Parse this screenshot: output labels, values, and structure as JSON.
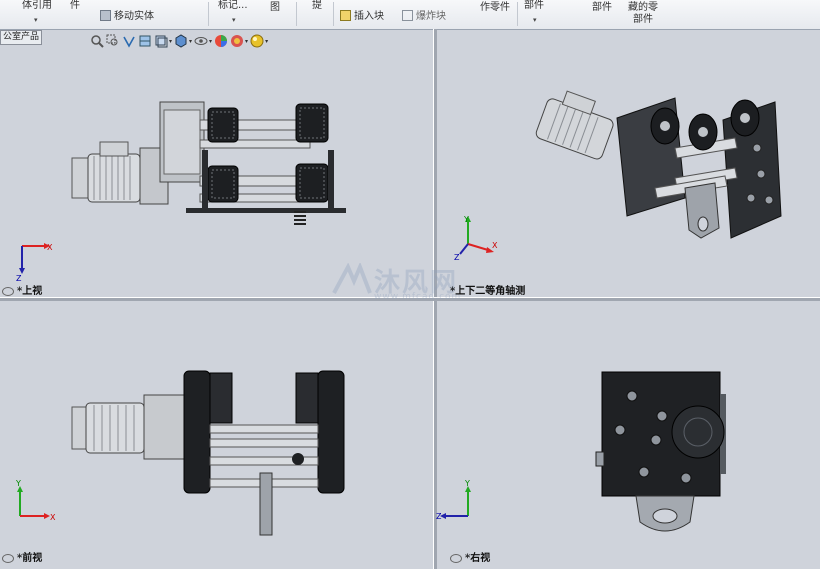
{
  "ribbon": {
    "item1": "体引用",
    "item2": "件",
    "item3": "移动实体",
    "item4": "标记...",
    "item5": "图",
    "item6": "提",
    "insert_block": "插入块",
    "explode_block": "爆炸块",
    "item9": "作零件",
    "item10": "部件",
    "item11": "部件",
    "item12_line1": "藏的零",
    "item12_line2": "部件"
  },
  "tab_label": "公室产品",
  "viewports": {
    "top": "*上视",
    "trimetric": "*上下二等角轴测",
    "front": "*前视",
    "right": "*右视"
  },
  "watermark": {
    "text": "沐风网",
    "url": "www.mfcad.com"
  },
  "triad_labels": {
    "x": "X",
    "y": "Y",
    "z": "Z"
  }
}
